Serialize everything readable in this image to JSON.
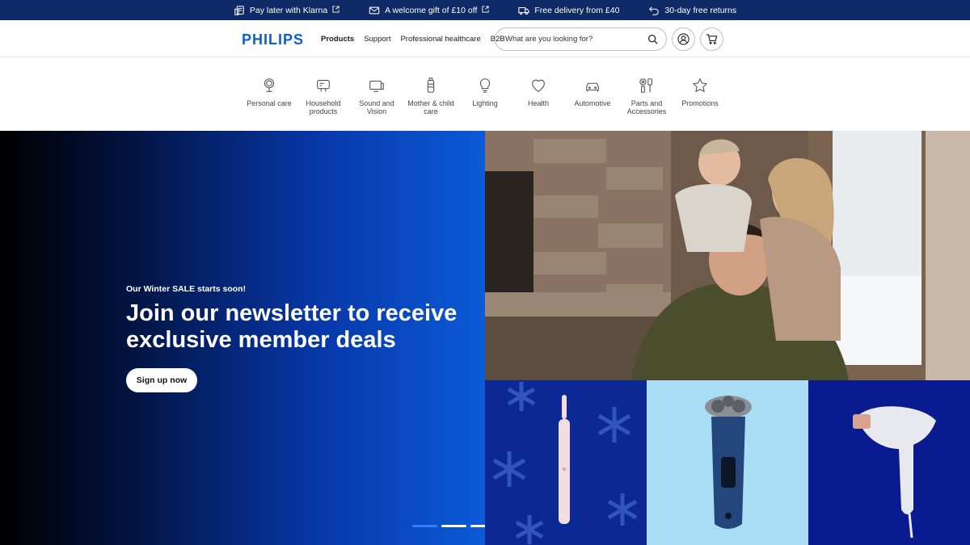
{
  "topbar": {
    "promos": [
      {
        "label": "Pay later with Klarna",
        "icon": "receipt-icon"
      },
      {
        "label": "A welcome gift of £10 off",
        "icon": "envelope-icon"
      },
      {
        "label": "Free delivery from £40",
        "icon": "truck-icon"
      },
      {
        "label": "30-day free returns",
        "icon": "return-arrow-icon"
      }
    ],
    "background": "#0e2a66"
  },
  "header": {
    "logo": "PHILIPS",
    "nav": [
      "Products",
      "Support",
      "Professional healthcare",
      "B2B"
    ],
    "search_placeholder": "What are you looking for?",
    "brand_color": "#0b5ed7"
  },
  "categories": [
    {
      "label": "Personal care",
      "icon": "mirror-icon"
    },
    {
      "label": "Household products",
      "icon": "appliance-icon"
    },
    {
      "label": "Sound and Vision",
      "icon": "tv-icon"
    },
    {
      "label": "Mother & child care",
      "icon": "baby-bottle-icon"
    },
    {
      "label": "Lighting",
      "icon": "bulb-icon"
    },
    {
      "label": "Health",
      "icon": "heart-icon"
    },
    {
      "label": "Automotive",
      "icon": "car-icon"
    },
    {
      "label": "Parts and Accessories",
      "icon": "parts-icon"
    },
    {
      "label": "Promotions",
      "icon": "star-icon"
    }
  ],
  "hero": {
    "kicker": "Our Winter SALE starts soon!",
    "headline": "Join our newsletter to receive exclusive member deals",
    "cta": "Sign up now"
  },
  "product_tiles": [
    "toothbrush-image",
    "shaver-image",
    "ipl-device-image"
  ]
}
